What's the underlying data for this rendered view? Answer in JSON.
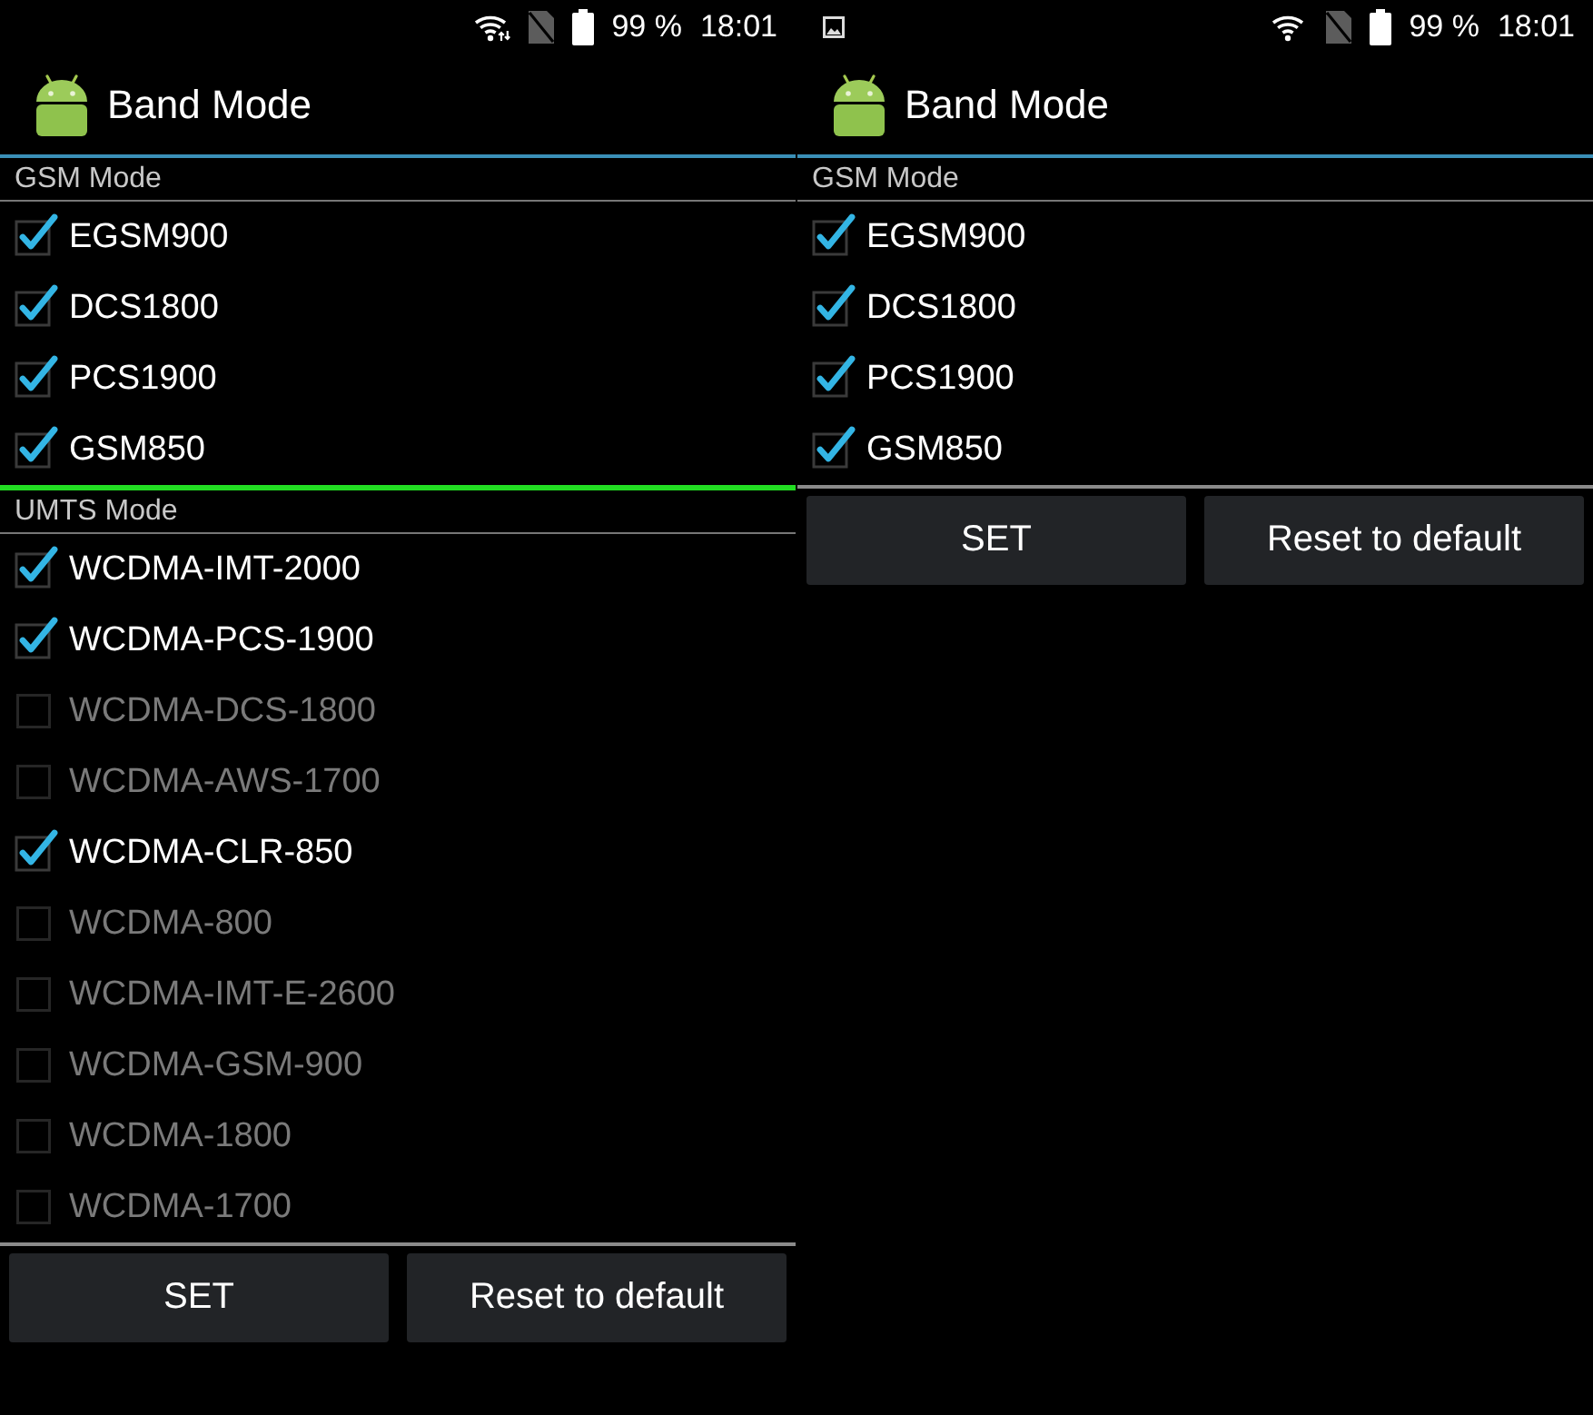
{
  "screens": [
    {
      "status_bar": {
        "wifi_activity": true,
        "battery": "99 %",
        "time": "18:01"
      },
      "app_bar": {
        "title": "Band Mode"
      },
      "sections": [
        {
          "title": "GSM Mode",
          "bands": [
            {
              "label": "EGSM900",
              "checked": true,
              "disabled": false
            },
            {
              "label": "DCS1800",
              "checked": true,
              "disabled": false
            },
            {
              "label": "PCS1900",
              "checked": true,
              "disabled": false
            },
            {
              "label": "GSM850",
              "checked": true,
              "disabled": false
            }
          ]
        },
        {
          "title": "UMTS Mode",
          "bands": [
            {
              "label": "WCDMA-IMT-2000",
              "checked": true,
              "disabled": false
            },
            {
              "label": "WCDMA-PCS-1900",
              "checked": true,
              "disabled": false
            },
            {
              "label": "WCDMA-DCS-1800",
              "checked": false,
              "disabled": true
            },
            {
              "label": "WCDMA-AWS-1700",
              "checked": false,
              "disabled": true
            },
            {
              "label": "WCDMA-CLR-850",
              "checked": true,
              "disabled": false
            },
            {
              "label": "WCDMA-800",
              "checked": false,
              "disabled": true
            },
            {
              "label": "WCDMA-IMT-E-2600",
              "checked": false,
              "disabled": true
            },
            {
              "label": "WCDMA-GSM-900",
              "checked": false,
              "disabled": true
            },
            {
              "label": "WCDMA-1800",
              "checked": false,
              "disabled": true
            },
            {
              "label": "WCDMA-1700",
              "checked": false,
              "disabled": true
            }
          ]
        }
      ],
      "buttons": [
        {
          "label": "SET"
        },
        {
          "label": "Reset to default"
        }
      ]
    },
    {
      "status_bar": {
        "notifications": [
          {
            "kind": "image"
          }
        ],
        "wifi_activity": false,
        "battery": "99 %",
        "time": "18:01"
      },
      "app_bar": {
        "title": "Band Mode"
      },
      "sections": [
        {
          "title": "GSM Mode",
          "bands": [
            {
              "label": "EGSM900",
              "checked": true,
              "disabled": false
            },
            {
              "label": "DCS1800",
              "checked": true,
              "disabled": false
            },
            {
              "label": "PCS1900",
              "checked": true,
              "disabled": false
            },
            {
              "label": "GSM850",
              "checked": true,
              "disabled": false
            }
          ]
        }
      ],
      "buttons": [
        {
          "label": "SET"
        },
        {
          "label": "Reset to default"
        }
      ]
    }
  ]
}
